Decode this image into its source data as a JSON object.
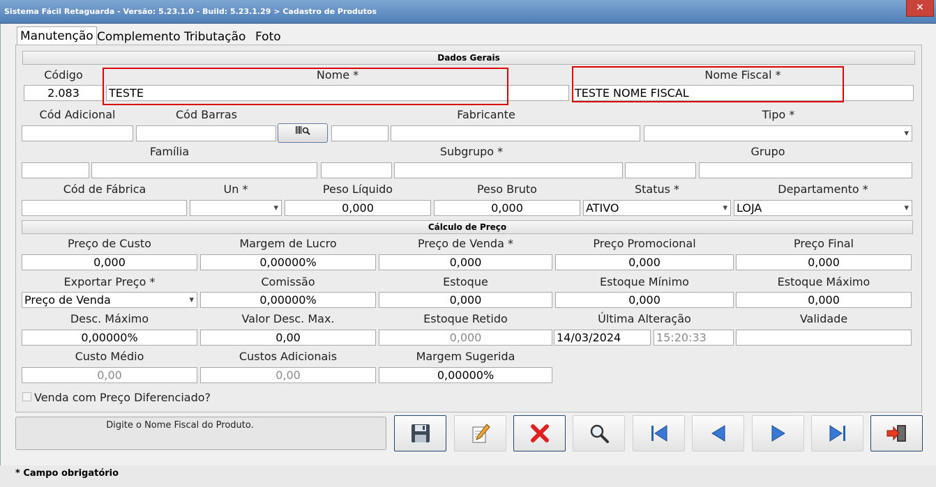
{
  "window": {
    "title": "Sistema Fácil Retaguarda - Versão: 5.23.1.0  - Build: 5.23.1.29 > Cadastro de Produtos",
    "close": "✕"
  },
  "tabs": [
    "Manutenção",
    "Complemento",
    "Tributação",
    "Foto"
  ],
  "sections": {
    "dados_gerais": "Dados Gerais",
    "calculo_preco": "Cálculo de Preço"
  },
  "fields": {
    "codigo": {
      "label": "Código",
      "value": "2.083"
    },
    "nome": {
      "label": "Nome *",
      "value": "TESTE"
    },
    "nome_fiscal": {
      "label": "Nome Fiscal *",
      "value": "TESTE NOME FISCAL"
    },
    "cod_adicional": {
      "label": "Cód Adicional",
      "value": ""
    },
    "cod_barras": {
      "label": "Cód Barras",
      "value": ""
    },
    "fabricante": {
      "label": "Fabricante",
      "code": "",
      "value": ""
    },
    "tipo": {
      "label": "Tipo *",
      "value": ""
    },
    "familia": {
      "label": "Família",
      "code": "",
      "value": ""
    },
    "subgrupo": {
      "label": "Subgrupo *",
      "code": "",
      "value": ""
    },
    "grupo": {
      "label": "Grupo",
      "code": "",
      "value": ""
    },
    "cod_fabrica": {
      "label": "Cód de Fábrica",
      "value": ""
    },
    "un": {
      "label": "Un *",
      "value": ""
    },
    "peso_liquido": {
      "label": "Peso Líquido",
      "value": "0,000"
    },
    "peso_bruto": {
      "label": "Peso Bruto",
      "value": "0,000"
    },
    "status": {
      "label": "Status *",
      "value": "ATIVO"
    },
    "departamento": {
      "label": "Departamento *",
      "value": "LOJA"
    },
    "preco_custo": {
      "label": "Preço de Custo",
      "value": "0,000"
    },
    "margem_lucro": {
      "label": "Margem de Lucro",
      "value": "0,00000%"
    },
    "preco_venda": {
      "label": "Preço de Venda *",
      "value": "0,000"
    },
    "preco_promocional": {
      "label": "Preço Promocional",
      "value": "0,000"
    },
    "preco_final": {
      "label": "Preço Final",
      "value": "0,000"
    },
    "exportar_preco": {
      "label": "Exportar Preço *",
      "value": "Preço de Venda"
    },
    "comissao": {
      "label": "Comissão",
      "value": "0,00000%"
    },
    "estoque": {
      "label": "Estoque",
      "value": "0,000"
    },
    "estoque_minimo": {
      "label": "Estoque Mínimo",
      "value": "0,000"
    },
    "estoque_maximo": {
      "label": "Estoque Máximo",
      "value": "0,000"
    },
    "desc_maximo": {
      "label": "Desc. Máximo",
      "value": "0,00000%"
    },
    "valor_desc_max": {
      "label": "Valor Desc. Max.",
      "value": "0,00"
    },
    "estoque_retido": {
      "label": "Estoque Retido",
      "value": "0,000"
    },
    "ultima_alteracao": {
      "label": "Última Alteração",
      "date": "14/03/2024",
      "time": "15:20:33"
    },
    "validade": {
      "label": "Validade",
      "value": ""
    },
    "custo_medio": {
      "label": "Custo Médio",
      "value": "0,00"
    },
    "custos_adicionais": {
      "label": "Custos Adicionais",
      "value": "0,00"
    },
    "margem_sugerida": {
      "label": "Margem Sugerida",
      "value": "0,00000%"
    }
  },
  "checkbox": {
    "label": "Venda com Preço Diferenciado?",
    "checked": false
  },
  "status_message": "Digite o Nome Fiscal do Produto.",
  "footer": "*  Campo obrigatório",
  "toolbar_icons": [
    "save-icon",
    "edit-icon",
    "delete-icon",
    "search-icon",
    "first-icon",
    "previous-icon",
    "next-icon",
    "last-icon",
    "exit-icon"
  ],
  "colors": {
    "highlight_box": "#e00000",
    "title_bar": "#5a88bd"
  }
}
